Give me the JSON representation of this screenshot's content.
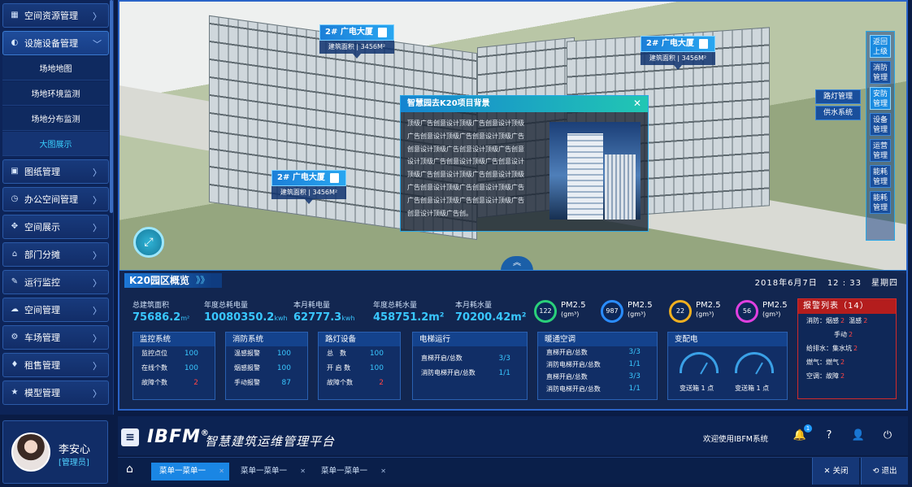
{
  "sidebar": {
    "items": [
      {
        "label": "空间资源管理",
        "icon": "grid-icon",
        "active": false
      },
      {
        "label": "设施设备管理",
        "icon": "globe-icon",
        "active": true
      },
      {
        "label": "图纸管理",
        "icon": "image-icon",
        "active": false
      },
      {
        "label": "办公空间管理",
        "icon": "clock-icon",
        "active": false
      },
      {
        "label": "空间展示",
        "icon": "cross-icon",
        "active": false
      },
      {
        "label": "部门分摊",
        "icon": "bank-icon",
        "active": false
      },
      {
        "label": "运行监控",
        "icon": "wrench-icon",
        "active": false
      },
      {
        "label": "空间管理",
        "icon": "cloud-icon",
        "active": false
      },
      {
        "label": "车场管理",
        "icon": "gear-icon",
        "active": false
      },
      {
        "label": "租售管理",
        "icon": "mic-icon",
        "active": false
      },
      {
        "label": "模型管理",
        "icon": "star-icon",
        "active": false
      }
    ],
    "subitems": [
      "场地地图",
      "场地环境监测",
      "场地分布监测",
      "大图展示"
    ],
    "active_sub": "大图展示"
  },
  "user": {
    "name": "李安心",
    "role": "[管理员]"
  },
  "scene": {
    "tags": [
      {
        "title": "2# 广电大厦",
        "area": "建筑面积 | 3456M²"
      },
      {
        "title": "2# 广电大厦",
        "area": "建筑面积 | 3456M²"
      },
      {
        "title": "2# 广电大厦",
        "area": "建筑面积 | 3456M²"
      }
    ],
    "popup": {
      "title": "智慧园去K20项目背景",
      "close": "✕",
      "lines": [
        "顶级广告创意设计顶级广告创意设计顶级",
        "广告创意设计顶级广告创意设计顶级广告",
        "创意设计顶级广告创意设计顶级广告创意",
        "设计顶级广告创意设计顶级广告创意设计",
        "顶级广告创意设计顶级广告创意设计顶级",
        "广告创意设计顶级广告创意设计顶级广告",
        "广告创意设计顶级广告创意设计顶级广告",
        "创意设计顶级广告创。"
      ]
    },
    "right_nav": [
      {
        "l1": "返回",
        "l2": "上级",
        "on": true
      },
      {
        "l1": "消防",
        "l2": "管理",
        "on": false
      },
      {
        "l1": "安防",
        "l2": "管理",
        "on": true
      },
      {
        "l1": "设备",
        "l2": "管理",
        "on": false
      },
      {
        "l1": "运营",
        "l2": "管理",
        "on": false
      },
      {
        "l1": "能耗",
        "l2": "管理",
        "on": false
      },
      {
        "l1": "能耗",
        "l2": "管理",
        "on": false
      }
    ],
    "right_sub": [
      "路灯管理",
      "供水系统"
    ]
  },
  "overview": {
    "title": "K20园区概览",
    "arrows": "》》",
    "date": "2018年6月7日",
    "time": "12 : 33",
    "weekday": "星期四",
    "kpis": [
      {
        "label": "总建筑面积",
        "value": "75686.2",
        "unit": "m²"
      },
      {
        "label": "年度总耗电量",
        "value": "10080350.2",
        "unit": "kwh"
      },
      {
        "label": "本月耗电量",
        "value": "62777.3",
        "unit": "kwh"
      },
      {
        "label": "年度总耗水量",
        "value": "458751.2m²",
        "unit": ""
      },
      {
        "label": "本月耗水量",
        "value": "70200.42m²",
        "unit": ""
      }
    ],
    "pm": [
      {
        "value": "122",
        "label": "PM2.5",
        "unit": "(gm³)",
        "color": "#2ad07a"
      },
      {
        "value": "987",
        "label": "PM2.5",
        "unit": "(gm³)",
        "color": "#2a8cff"
      },
      {
        "value": "22",
        "label": "PM2.5",
        "unit": "(gm³)",
        "color": "#f0b020"
      },
      {
        "value": "56",
        "label": "PM2.5",
        "unit": "(gm³)",
        "color": "#e040e0"
      }
    ],
    "monitor": {
      "title": "监控系统",
      "rows": [
        [
          "监控点位",
          "100"
        ],
        [
          "在线个数",
          "100"
        ],
        [
          "故障个数",
          "2"
        ]
      ]
    },
    "fire": {
      "title": "消防系统",
      "rows": [
        [
          "温感报警",
          "100"
        ],
        [
          "烟感报警",
          "100"
        ],
        [
          "手动报警",
          "87"
        ]
      ]
    },
    "lamp": {
      "title": "路灯设备",
      "rows": [
        [
          "总　数",
          "100"
        ],
        [
          "开 启 数",
          "100"
        ],
        [
          "故障个数",
          "2"
        ]
      ]
    },
    "elevator": {
      "title": "电梯运行",
      "rows": [
        [
          "直梯开启/总数",
          "3/3"
        ],
        [
          "消防电梯开启/总数",
          "1/1"
        ]
      ]
    },
    "hvac": {
      "title": "暖通空调",
      "rows": [
        [
          "直梯开启/总数",
          "3/3"
        ],
        [
          "消防电梯开启/总数",
          "1/1"
        ],
        [
          "直梯开启/总数",
          "3/3"
        ],
        [
          "消防电梯开启/总数",
          "1/1"
        ]
      ]
    },
    "power": {
      "title": "变配电",
      "gauges": [
        "变送箱 1 点",
        "变送箱 1 点"
      ]
    },
    "alarm": {
      "title": "报警列表（14）",
      "rows": [
        [
          "消防：烟感",
          "2",
          "温感",
          "2"
        ],
        [
          "手动",
          "2",
          "",
          ""
        ],
        [
          "给排水：集水坑",
          "2",
          "",
          ""
        ],
        [
          "燃气：燃气",
          "2",
          "",
          ""
        ],
        [
          "空调：故障",
          "2",
          "",
          ""
        ]
      ]
    }
  },
  "header": {
    "logo": "IBFM",
    "reg": "®",
    "title": "智慧建筑运维管理平台",
    "welcome": "欢迎使用IBFM系统",
    "badge": "1"
  },
  "tabs": {
    "items": [
      "菜单一菜单一",
      "菜单一菜单一",
      "菜单一菜单一"
    ],
    "close_all": "✕ 关闭",
    "logout": "⟲ 退出"
  },
  "colors": {
    "accent": "#1a86e4",
    "alarm": "#ff4545",
    "value": "#39c7ff"
  }
}
